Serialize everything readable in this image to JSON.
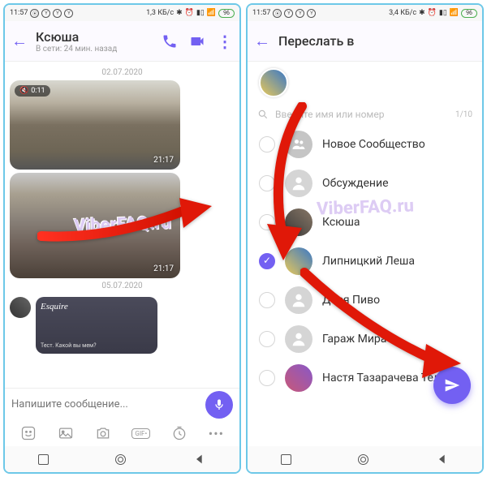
{
  "status": {
    "time": "11:57",
    "net1": "1,3 КБ/с",
    "net2": "3,4 КБ/с",
    "batt": "96"
  },
  "chat": {
    "name": "Ксюша",
    "substatus": "В сети: 24 мин. назад",
    "date1": "02.07.2020",
    "date2": "05.07.2020",
    "vid_dur": "0:11",
    "ts1": "21:17",
    "ts2": "21:17",
    "card_title": "Esquire",
    "card_sub": "Тест. Какой вы мем?",
    "placeholder": "Напишите сообщение..."
  },
  "forward": {
    "title": "Переслать в",
    "search_placeholder": "Введите имя или номер",
    "counter": "1/10",
    "items": [
      {
        "name": "Новое Сообщество",
        "check": false,
        "avatar": "group"
      },
      {
        "name": "Обсуждение",
        "check": false,
        "avatar": "gray"
      },
      {
        "name": "Ксюша",
        "check": false,
        "avatar": "photo1"
      },
      {
        "name": "Липницкий Леша",
        "check": true,
        "avatar": "photo2"
      },
      {
        "name": "Дося Пиво",
        "check": false,
        "avatar": "gray"
      },
      {
        "name": "Гараж Мира",
        "check": false,
        "avatar": "gray"
      },
      {
        "name": "Настя Тазарачева Теле2",
        "check": false,
        "avatar": "photo3"
      }
    ]
  },
  "watermark": "ViberFAQ.ru"
}
